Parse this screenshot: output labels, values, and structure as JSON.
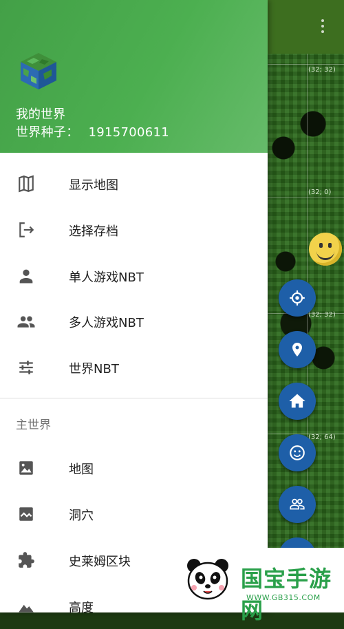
{
  "header": {
    "world_name": "我的世界",
    "seed_label": "世界种子：",
    "seed_value": "1915700611"
  },
  "menu": {
    "items": [
      {
        "label": "显示地图",
        "icon": "map-icon"
      },
      {
        "label": "选择存档",
        "icon": "exit-icon"
      },
      {
        "label": "单人游戏NBT",
        "icon": "person-icon"
      },
      {
        "label": "多人游戏NBT",
        "icon": "people-icon"
      },
      {
        "label": "世界NBT",
        "icon": "tune-icon"
      }
    ]
  },
  "section": {
    "title": "主世界",
    "items": [
      {
        "label": "地图",
        "icon": "image-icon"
      },
      {
        "label": "洞穴",
        "icon": "terrain-icon"
      },
      {
        "label": "史莱姆区块",
        "icon": "puzzle-icon"
      },
      {
        "label": "高度",
        "icon": "mountain-icon"
      }
    ]
  },
  "map": {
    "coords": [
      "(32; 32)",
      "(32; 0)",
      "(32; 32)",
      "(32; 64)"
    ]
  },
  "watermark": {
    "text": "国宝手游网",
    "url": "WWW.GB315.COM"
  },
  "colors": {
    "header_green": "#4caf50",
    "fab_blue": "#1e5fa8",
    "watermark_green": "#2aa04a"
  }
}
